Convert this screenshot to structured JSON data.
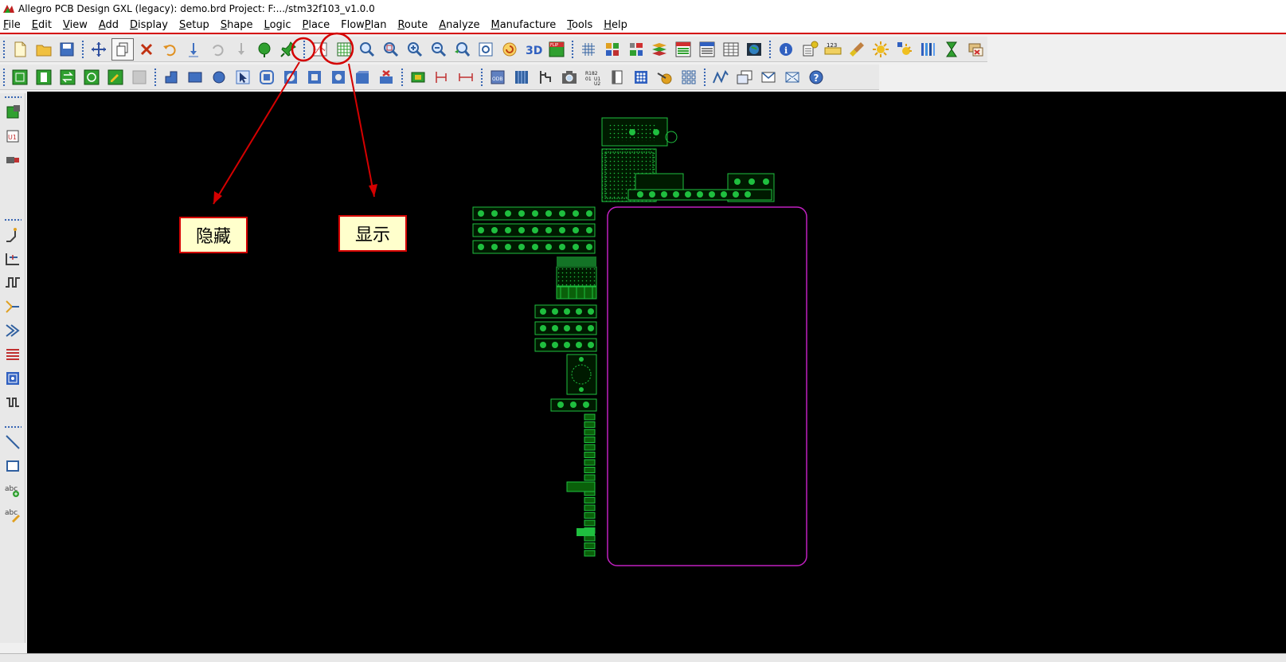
{
  "window": {
    "title": "Allegro PCB Design GXL (legacy): demo.brd  Project: F:.../stm32f103_v1.0.0"
  },
  "menu": {
    "items": [
      {
        "label": "File",
        "key": "F"
      },
      {
        "label": "Edit",
        "key": "E"
      },
      {
        "label": "View",
        "key": "V"
      },
      {
        "label": "Add",
        "key": "A"
      },
      {
        "label": "Display",
        "key": "D"
      },
      {
        "label": "Setup",
        "key": "S"
      },
      {
        "label": "Shape",
        "key": "S"
      },
      {
        "label": "Logic",
        "key": "L"
      },
      {
        "label": "Place",
        "key": "P"
      },
      {
        "label": "FlowPlan",
        "key": "P"
      },
      {
        "label": "Route",
        "key": "R"
      },
      {
        "label": "Analyze",
        "key": "A"
      },
      {
        "label": "Manufacture",
        "key": "M"
      },
      {
        "label": "Tools",
        "key": "T"
      },
      {
        "label": "Help",
        "key": "H"
      }
    ]
  },
  "toolbar": {
    "icons_row1": [
      "new-file-icon",
      "open-folder-icon",
      "save-icon",
      "move-icon",
      "copy-icon",
      "delete-icon",
      "undo-icon",
      "redo-icon",
      "undo-disabled-icon",
      "redo-disabled-icon",
      "ratsnest-icon",
      "pin-icon",
      "hide-ratsnest-icon",
      "show-ratsnest-icon",
      "zoom-fit-icon",
      "zoom-in-area-icon",
      "zoom-in-icon",
      "zoom-out-icon",
      "zoom-previous-icon",
      "zoom-world-icon",
      "redraw-icon",
      "3d-view-icon",
      "flip-board-icon",
      "grid-icon",
      "color-dialog-icon",
      "layer-visibility-icon",
      "stackup-icon",
      "cm-icon",
      "dfa-icon",
      "spreadsheet-icon",
      "world-icon",
      "info-icon",
      "measure-icon",
      "ruler-icon",
      "brush-icon",
      "shadow-mode-icon",
      "highlight-icon",
      "color-bars-icon",
      "hourglass-icon",
      "unrats-icon"
    ],
    "icons_row2": [
      "place-manual-icon",
      "quickplace-icon",
      "swap-icon",
      "place-replicate-icon",
      "place-edit-icon",
      "disabled-icon",
      "shape-polygon-icon",
      "shape-rect-icon",
      "shape-circle-icon",
      "select-shape-icon",
      "merge-shape-icon",
      "shape-void-icon",
      "void-rect-icon",
      "void-circle-icon",
      "edit-boundary-icon",
      "delete-island-icon",
      "testpoint-icon",
      "dimension-icon",
      "dimension-linear-icon",
      "odb-export-icon",
      "via-icon",
      "tuning-icon",
      "camera-icon",
      "refdes-icon",
      "label-icon",
      "array-icon",
      "probe-icon",
      "matrix-icon",
      "curve-icon",
      "multiwindow-icon",
      "envelope-icon",
      "mail-icon",
      "help-icon"
    ],
    "hide_tooltip": "隐藏",
    "show_tooltip": "显示"
  },
  "left_palette": {
    "icons": [
      "component-icon",
      "u1-part-icon",
      "connector-icon",
      "add-connect-icon",
      "slide-icon",
      "delay-tune-icon",
      "custom-smooth-icon",
      "fanout-icon",
      "bus-route-icon",
      "auto-route-icon",
      "route-timing-icon",
      "add-line-icon",
      "add-rect-icon",
      "add-text-icon",
      "edit-text-icon"
    ]
  },
  "annotations": {
    "hide_label": "隐藏",
    "show_label": "显示"
  },
  "colors": {
    "accent_red": "#d40000",
    "pcb_background": "#000000",
    "pcb_green": "#1fbf3f",
    "pcb_outline": "#c020c0"
  }
}
